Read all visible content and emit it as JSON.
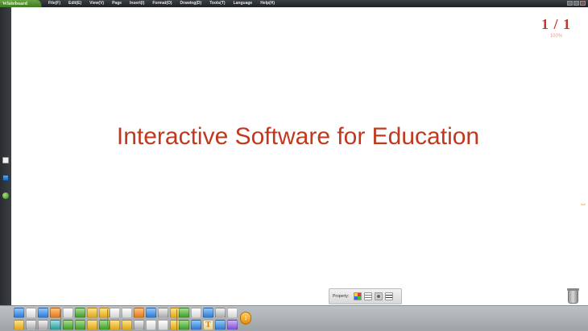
{
  "app": {
    "title": "Whiteboard"
  },
  "menu": {
    "items": [
      "File(F)",
      "Edit(E)",
      "View(V)",
      "Page",
      "Insert(I)",
      "Format(O)",
      "Drawing(D)",
      "Tools(T)",
      "Language",
      "Help(H)"
    ]
  },
  "page": {
    "indicator": "1 / 1",
    "zoom": "100%"
  },
  "canvas": {
    "text": "Interactive Software for Education",
    "text_color": "#c0391f"
  },
  "property": {
    "label": "Property:"
  },
  "toolbar": {
    "groups": [
      [
        "open-icon",
        "copy-icon",
        "undo-icon",
        "pointer-icon",
        "save-icon",
        "paste-icon",
        "redo-icon",
        "screen-icon"
      ],
      [
        "new-page-icon",
        "pages-icon",
        "zoom-in-icon",
        "zoom-out-icon",
        "prev-page-icon",
        "next-page-icon",
        "hand-icon",
        "refresh-icon"
      ],
      [
        "screen-capture-icon",
        "fullscreen-icon",
        "brush-icon",
        "keyboard-icon",
        "record-icon",
        "bulb-icon",
        "search-icon",
        "folder-icon",
        "camera-icon",
        "calendar-icon",
        "clock-icon",
        "magic-icon"
      ],
      [
        "sync-icon",
        "window-icon",
        "image-icon",
        "compass-icon",
        "notes-icon",
        "pen-icon",
        "ruler-icon",
        "text-icon",
        "user-icon",
        "shapes-icon"
      ]
    ],
    "text_tool_glyph": "T"
  },
  "colors": {
    "accent": "#c0392b",
    "menubar": "#2a2d30",
    "toolbar": "#aeb3b8"
  }
}
